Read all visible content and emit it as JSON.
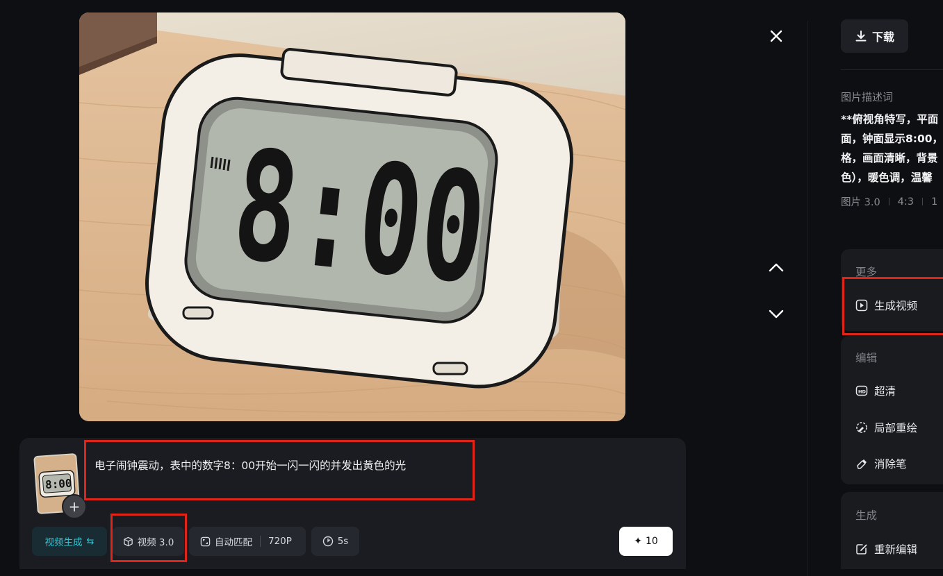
{
  "image": {
    "alt": "",
    "clock_display": "8:00"
  },
  "viewer": {
    "close_icon": "close-icon",
    "prev_icon": "chevron-up-icon",
    "next_icon": "chevron-down-icon"
  },
  "prompt_panel": {
    "thumbnail_text": "8:00",
    "add_label": "+",
    "prompt_text": "电子闹钟震动，表中的数字8：00开始一闪一闪的并发出黄色的光",
    "mode_label": "视频生成",
    "mode_swap_icon": "⇆",
    "model_label": "视频 3.0",
    "ratio_label": "自动匹配",
    "resolution_label": "720P",
    "duration_label": "5s",
    "generate_credits": "10",
    "generate_icon": "✦",
    "accent_color": "#27c7d8",
    "highlight_color": "#e02418"
  },
  "sidebar": {
    "download_label": "下载",
    "description_label": "图片描述词",
    "description_lines": [
      "**俯视角特写，平面",
      "面，钟面显示8:00，",
      "格，画面清晰，背景",
      "色），暖色调，温馨"
    ],
    "meta": [
      "图片 3.0",
      "4:3",
      "1"
    ],
    "more": {
      "title": "更多",
      "items": [
        {
          "label": "生成视频",
          "icon": "play-icon"
        }
      ]
    },
    "edit": {
      "title": "编辑",
      "items": [
        {
          "label": "超清",
          "icon": "hd-icon"
        },
        {
          "label": "局部重绘",
          "icon": "brush-icon"
        },
        {
          "label": "消除笔",
          "icon": "eraser-icon"
        }
      ]
    },
    "generate": {
      "title": "生成",
      "items": [
        {
          "label": "重新编辑",
          "icon": "edit-icon"
        }
      ]
    }
  }
}
